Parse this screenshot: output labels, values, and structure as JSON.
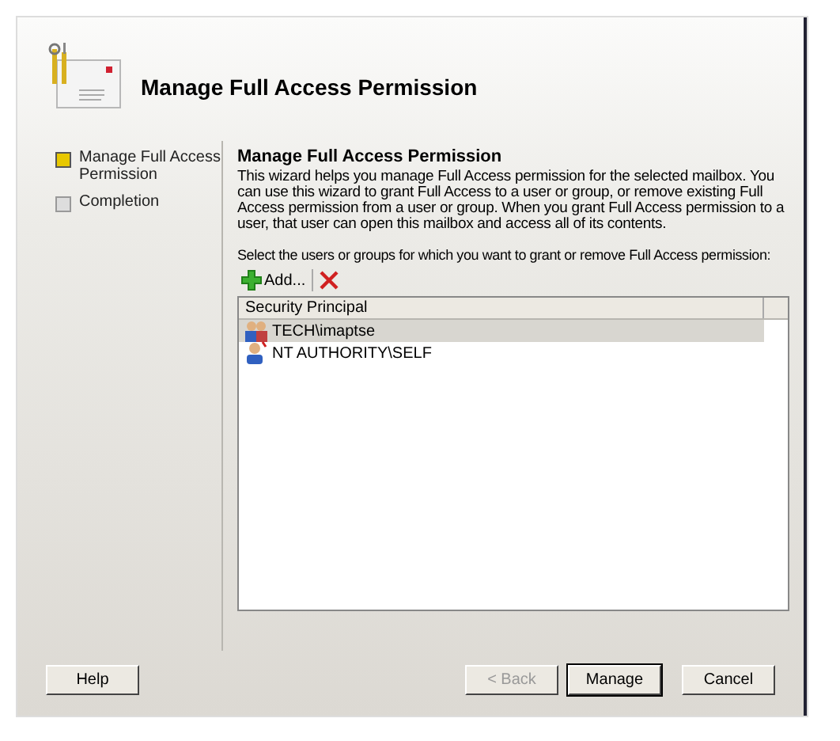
{
  "window": {
    "title": "Manage Full Access Permission"
  },
  "steps": [
    {
      "label": "Manage Full Access Permission",
      "selected": true
    },
    {
      "label": "Completion",
      "selected": false
    }
  ],
  "page": {
    "heading": "Manage Full Access Permission",
    "description": "This wizard helps you manage Full Access permission for the selected mailbox. You can use this wizard to grant Full Access to a user or group, or remove existing Full Access permission from a user or group. When you grant Full Access permission to a user, that user can open this mailbox and access all of its contents.",
    "prompt": "Select the users or groups for which you want to grant or remove Full Access permission:"
  },
  "toolbar": {
    "add": "Add..."
  },
  "table": {
    "columns": [
      "Security Principal"
    ],
    "rows": [
      {
        "name": "TECH\\imaptse",
        "kind": "group",
        "selected": true
      },
      {
        "name": "NT AUTHORITY\\SELF",
        "kind": "user",
        "selected": false
      }
    ]
  },
  "buttons": [
    {
      "label": "Help",
      "kind": "help",
      "disabled": false,
      "default": false
    },
    {
      "label": "< Back",
      "kind": "nav",
      "disabled": true,
      "default": false
    },
    {
      "label": "Manage",
      "kind": "nav",
      "disabled": false,
      "default": true
    },
    {
      "label": "Cancel",
      "kind": "cancel",
      "disabled": false,
      "default": false
    }
  ]
}
